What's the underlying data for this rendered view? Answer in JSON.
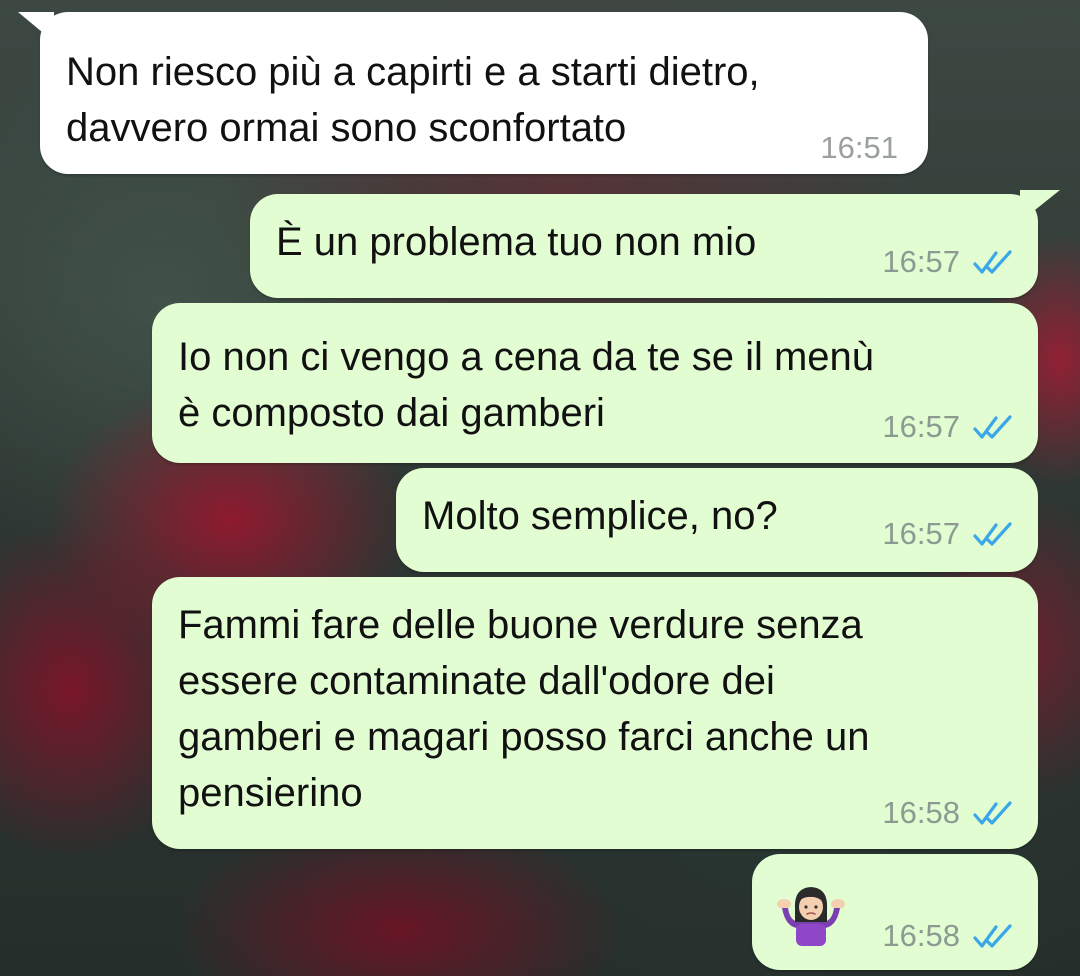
{
  "conversation": {
    "messages": [
      {
        "direction": "incoming",
        "text": "Non riesco più a capirti e a starti dietro,\ndavvero ormai sono sconfortato",
        "time": "16:51"
      },
      {
        "direction": "outgoing",
        "text": "È un problema tuo non mio",
        "time": "16:57",
        "status": "read"
      },
      {
        "direction": "outgoing",
        "text": "Io non ci vengo a cena da te se il menù\nè composto dai gamberi",
        "time": "16:57",
        "status": "read"
      },
      {
        "direction": "outgoing",
        "text": "Molto semplice, no?",
        "time": "16:57",
        "status": "read"
      },
      {
        "direction": "outgoing",
        "text": "Fammi fare delle buone verdure senza\nessere contaminate dall'odore dei\ngamberi e magari posso farci anche un\npensierino",
        "time": "16:58",
        "status": "read"
      },
      {
        "direction": "outgoing",
        "emoji": "person-shrugging-emoji",
        "time": "16:58",
        "status": "read"
      }
    ]
  },
  "colors": {
    "incoming_bubble": "#ffffff",
    "outgoing_bubble": "#e2fdd2",
    "read_ticks": "#3aa7e8",
    "timestamp": "#8d9a92"
  }
}
